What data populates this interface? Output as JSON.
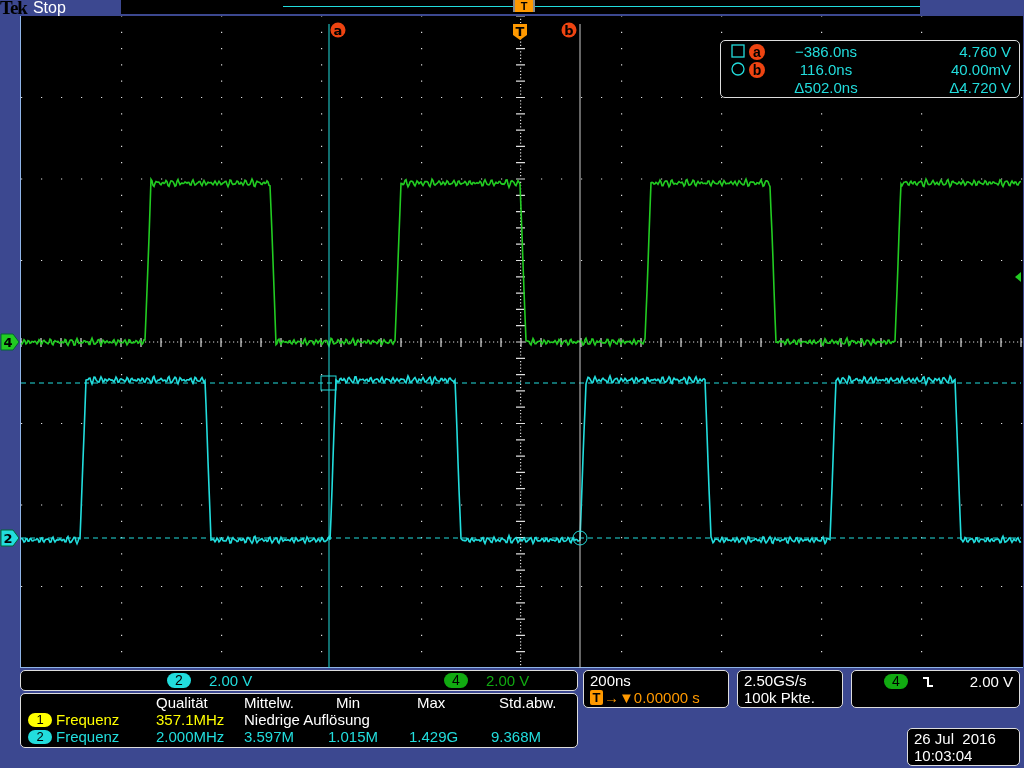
{
  "header": {
    "brand": "Tek",
    "status": "Stop",
    "trigger_label": "T"
  },
  "cursor_labels": [
    {
      "kind": "cursor",
      "label": "a"
    },
    {
      "kind": "trigger",
      "label": "T"
    },
    {
      "kind": "cursor",
      "label": "b"
    }
  ],
  "channels": [
    {
      "number": "4",
      "color": "#22cc22"
    },
    {
      "number": "2",
      "color": "#22dddd"
    }
  ],
  "cursor_readout": [
    {
      "kind": "square",
      "label": "a",
      "time": "−386.0ns",
      "value": "4.760 V"
    },
    {
      "kind": "circle",
      "label": "b",
      "time": "116.0ns",
      "value": "40.00mV"
    },
    {
      "kind": "delta",
      "time": "Δ502.0ns",
      "value": "Δ4.720 V"
    }
  ],
  "vertical_scales": [
    {
      "channel": "2",
      "scale": "2.00 V",
      "color": "#22dddd"
    },
    {
      "channel": "4",
      "scale": "2.00 V",
      "color": "#11aa11"
    }
  ],
  "measurements": {
    "columns": [
      "Qualität",
      "Mittelw.",
      "Min",
      "Max",
      "Std.abw."
    ],
    "rows": [
      {
        "channel": "1",
        "name": "Frequenz",
        "color": "#ffff00",
        "cells": [
          {
            "kind": "value",
            "text": "357.1MHz"
          },
          {
            "kind": "note",
            "text": "Niedrige Auflösung"
          }
        ]
      },
      {
        "channel": "2",
        "name": "Frequenz",
        "color": "#22dddd",
        "cells": [
          {
            "kind": "value",
            "text": "2.000MHz"
          },
          {
            "kind": "value",
            "text": "3.597M"
          },
          {
            "kind": "value",
            "text": "1.015M"
          },
          {
            "kind": "value",
            "text": "1.429G"
          },
          {
            "kind": "value",
            "text": "9.368M"
          }
        ]
      }
    ]
  },
  "horizontal": {
    "timebase": "200ns",
    "trigger_icon": "T",
    "delay_arrows": "→▼",
    "delay": "0.00000 s"
  },
  "acquisition": {
    "sample_rate": "2.50GS/s",
    "record_length": "100k Pkte."
  },
  "trigger": {
    "source": "4",
    "color": "#11aa11",
    "kind": "falling",
    "level": "2.00 V"
  },
  "datetime": {
    "date": "26 Jul  2016",
    "time": "10:03:04"
  }
}
